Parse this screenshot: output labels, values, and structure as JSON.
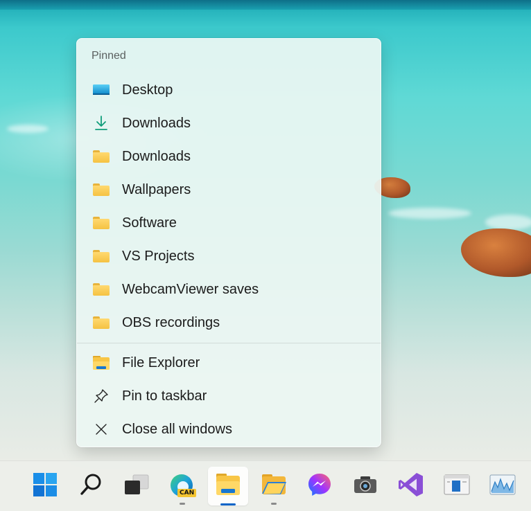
{
  "jumplist": {
    "section_label": "Pinned",
    "pinned": [
      {
        "label": "Desktop",
        "icon": "desktop-icon"
      },
      {
        "label": "Downloads",
        "icon": "download-arrow-icon"
      },
      {
        "label": "Downloads",
        "icon": "folder-icon"
      },
      {
        "label": "Wallpapers",
        "icon": "folder-icon"
      },
      {
        "label": "Software",
        "icon": "folder-icon"
      },
      {
        "label": "VS Projects",
        "icon": "folder-icon"
      },
      {
        "label": "WebcamViewer saves",
        "icon": "folder-icon"
      },
      {
        "label": "OBS recordings",
        "icon": "folder-icon"
      }
    ],
    "actions": [
      {
        "label": "File Explorer",
        "icon": "file-explorer-icon"
      },
      {
        "label": "Pin to taskbar",
        "icon": "pin-icon"
      },
      {
        "label": "Close all windows",
        "icon": "close-icon"
      }
    ]
  },
  "taskbar": {
    "edge_badge": "CAN",
    "apps": [
      {
        "name": "Start",
        "icon": "windows-start-icon"
      },
      {
        "name": "Search",
        "icon": "search-icon"
      },
      {
        "name": "Task View",
        "icon": "task-view-icon"
      },
      {
        "name": "Microsoft Edge Canary",
        "icon": "edge-canary-icon",
        "running": true
      },
      {
        "name": "File Explorer",
        "icon": "file-explorer-icon",
        "active": true
      },
      {
        "name": "Files",
        "icon": "files-folder-icon",
        "running": true
      },
      {
        "name": "Messenger",
        "icon": "messenger-icon"
      },
      {
        "name": "Camera",
        "icon": "camera-icon"
      },
      {
        "name": "Visual Studio",
        "icon": "visual-studio-icon"
      },
      {
        "name": "Window app",
        "icon": "app-window-icon"
      },
      {
        "name": "Performance monitor",
        "icon": "performance-chart-icon"
      }
    ]
  },
  "colors": {
    "accent": "#0a64c8",
    "folder_yellow": "#f5c242",
    "download_green": "#0f9d7a"
  }
}
